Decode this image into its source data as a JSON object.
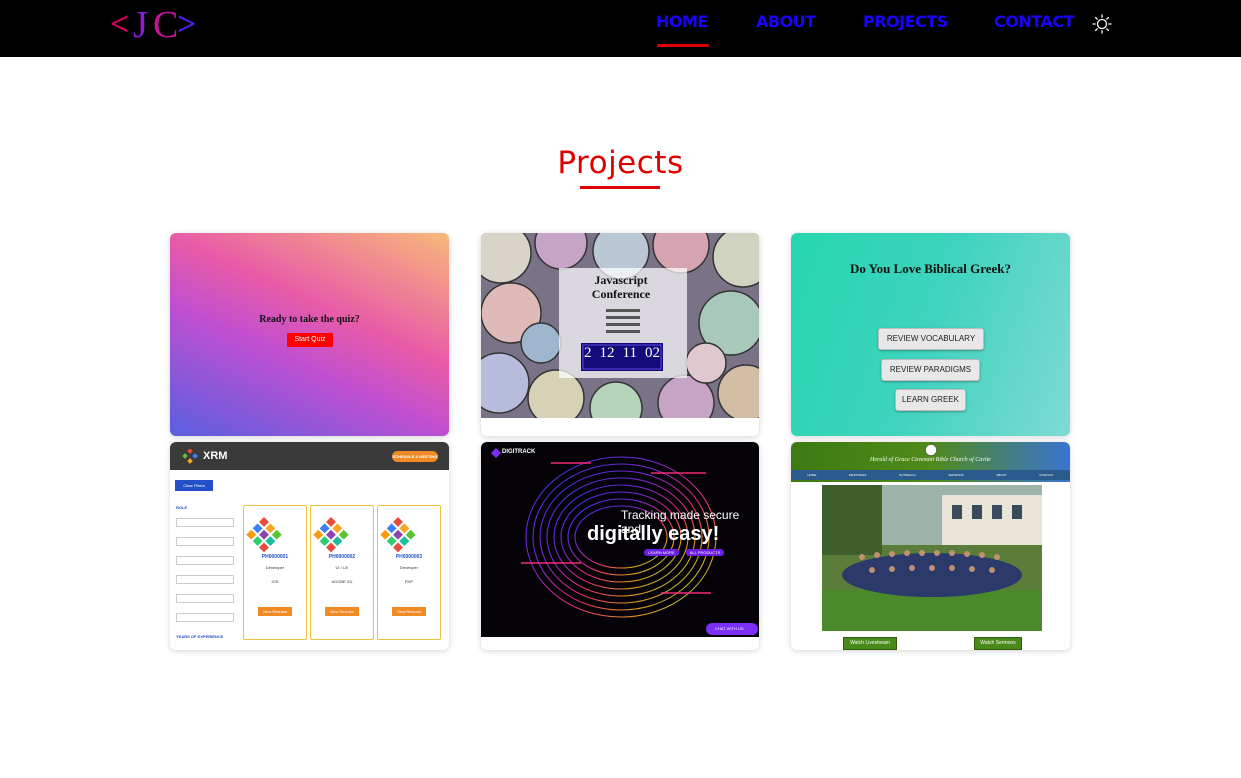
{
  "nav": {
    "logo_text": "<JC>",
    "links": [
      {
        "label": "HOME"
      },
      {
        "label": "ABOUT"
      },
      {
        "label": "PROJECTS"
      },
      {
        "label": "CONTACT"
      }
    ],
    "theme_icon": "sun-icon"
  },
  "projects": {
    "title": "Projects",
    "cards": [
      {
        "name": "quiz",
        "heading": "Ready to take the quiz?",
        "button": "Start Quiz"
      },
      {
        "name": "conference",
        "heading": "Javascript Conference",
        "countdown": [
          "2",
          "12",
          "11",
          "02"
        ]
      },
      {
        "name": "biblical-greek",
        "heading": "Do You Love Biblical Greek?",
        "buttons": [
          "REVIEW VOCABULARY",
          "REVIEW PARADIGMS",
          "LEARN GREEK"
        ]
      },
      {
        "name": "xrm",
        "brand": "XRM",
        "cta": "SCHEDULE A MEETING",
        "filter_button": "Clear Filters",
        "side_label_top": "ROLE",
        "side_label_bottom": "YEARS OF EXPERIENCE",
        "profiles": [
          {
            "id": "PH0000001",
            "role": "Developer",
            "skill": "IOS"
          },
          {
            "id": "PH0000002",
            "role": "UI / UX",
            "skill": "ADOBE XD"
          },
          {
            "id": "PH0000003",
            "role": "Developer",
            "skill": "PHP"
          }
        ],
        "profile_button": "View Resume"
      },
      {
        "name": "digitrack",
        "brand": "DIGITRACK",
        "line1": "Tracking made secure and",
        "line2": "digitally easy!",
        "btn1": "LEARN MORE",
        "btn2": "ALL PRODUCTS",
        "chat": "CHAT WITH US"
      },
      {
        "name": "church",
        "heading": "Herald of Grace Covenant Bible Church of Cavite",
        "nav_items": [
          "HOME",
          "MINISTRIES",
          "OUTREACH",
          "SERMONS",
          "ABOUT",
          "CONTACT"
        ],
        "btn1": "Watch Livestream",
        "btn2": "Watch Sermons"
      }
    ]
  },
  "colors": {
    "accent": "#e00000",
    "nav_link": "#1a00ff",
    "navbar_bg": "#000000"
  }
}
